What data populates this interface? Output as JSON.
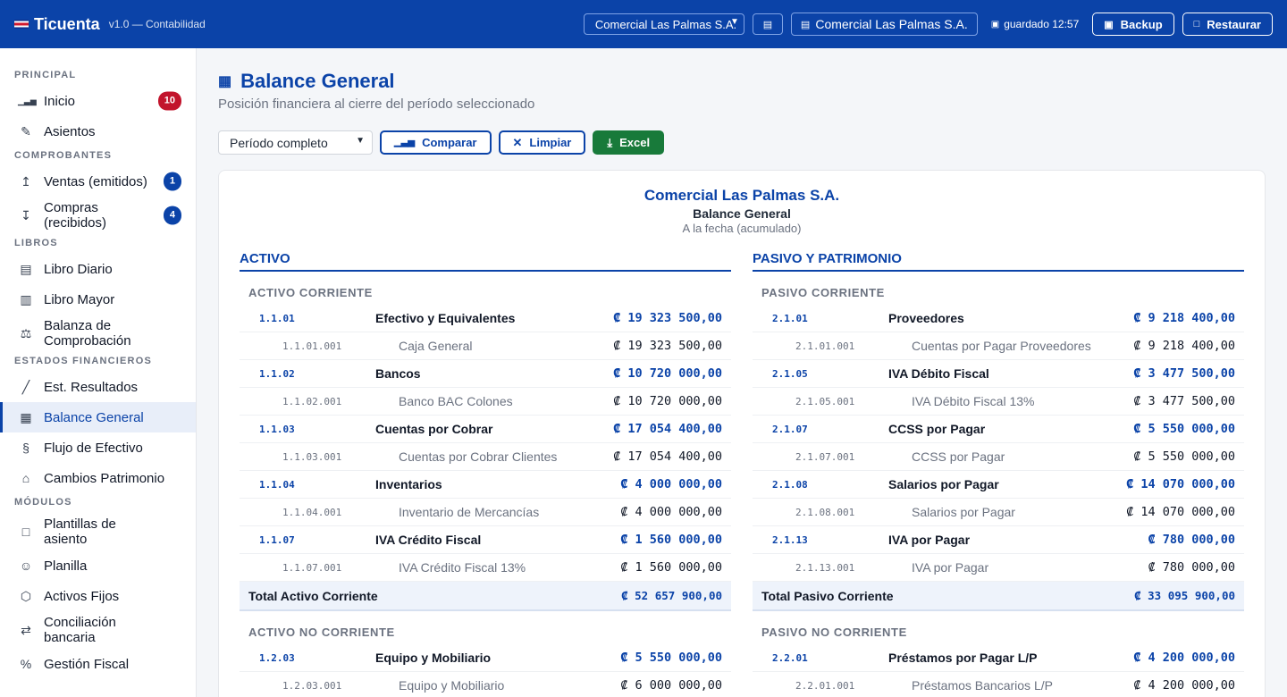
{
  "header": {
    "brand": "Ticuenta",
    "version": "v1.0 — Contabilidad",
    "company_select": "Comercial Las Palmas S.A.",
    "company_chip": "Comercial Las Palmas S.A.",
    "saved": "guardado 12:57",
    "backup_label": "Backup",
    "restore_label": "Restaurar"
  },
  "sidebar": {
    "sections": [
      {
        "title": "PRINCIPAL",
        "items": [
          {
            "label": "Inicio",
            "icon": "chart-icon",
            "badge": "10",
            "badge_color": "#c2142c"
          },
          {
            "label": "Asientos",
            "icon": "pencil-icon"
          }
        ]
      },
      {
        "title": "COMPROBANTES",
        "items": [
          {
            "label": "Ventas (emitidos)",
            "icon": "upload-icon",
            "badge": "1",
            "badge_color": "#0b43a8"
          },
          {
            "label": "Compras (recibidos)",
            "icon": "download-icon",
            "badge": "4",
            "badge_color": "#0b43a8"
          }
        ]
      },
      {
        "title": "LIBROS",
        "items": [
          {
            "label": "Libro Diario",
            "icon": "book-icon"
          },
          {
            "label": "Libro Mayor",
            "icon": "open-book-icon"
          },
          {
            "label": "Balanza de Comprobación",
            "icon": "scale-icon"
          }
        ]
      },
      {
        "title": "ESTADOS FINANCIEROS",
        "items": [
          {
            "label": "Est. Resultados",
            "icon": "line-chart-icon"
          },
          {
            "label": "Balance General",
            "icon": "table-icon",
            "active": true
          },
          {
            "label": "Flujo de Efectivo",
            "icon": "currency-icon"
          },
          {
            "label": "Cambios Patrimonio",
            "icon": "bank-icon"
          }
        ]
      },
      {
        "title": "MÓDULOS",
        "items": [
          {
            "label": "Plantillas de asiento",
            "icon": "template-icon"
          },
          {
            "label": "Planilla",
            "icon": "user-icon"
          },
          {
            "label": "Activos Fijos",
            "icon": "cube-icon"
          },
          {
            "label": "Conciliación bancaria",
            "icon": "swap-icon"
          },
          {
            "label": "Gestión Fiscal",
            "icon": "percent-icon"
          }
        ]
      }
    ]
  },
  "page": {
    "title": "Balance General",
    "subtitle": "Posición financiera al cierre del período seleccionado",
    "period": "Período completo",
    "compare_label": "Comparar",
    "clear_label": "Limpiar",
    "excel_label": "Excel"
  },
  "report": {
    "company": "Comercial Las Palmas S.A.",
    "title": "Balance General",
    "date": "A la fecha (acumulado)",
    "columns": [
      {
        "heading": "ACTIVO",
        "groups": [
          {
            "title": "ACTIVO CORRIENTE",
            "rows": [
              {
                "type": "parent",
                "code": "1.1.01",
                "name": "Efectivo y Equivalentes",
                "amount": "₡ 19 323 500,00"
              },
              {
                "type": "child",
                "code": "1.1.01.001",
                "name": "Caja General",
                "amount": "₡ 19 323 500,00"
              },
              {
                "type": "parent",
                "code": "1.1.02",
                "name": "Bancos",
                "amount": "₡ 10 720 000,00"
              },
              {
                "type": "child",
                "code": "1.1.02.001",
                "name": "Banco BAC Colones",
                "amount": "₡ 10 720 000,00"
              },
              {
                "type": "parent",
                "code": "1.1.03",
                "name": "Cuentas por Cobrar",
                "amount": "₡ 17 054 400,00"
              },
              {
                "type": "child",
                "code": "1.1.03.001",
                "name": "Cuentas por Cobrar Clientes",
                "amount": "₡ 17 054 400,00"
              },
              {
                "type": "parent",
                "code": "1.1.04",
                "name": "Inventarios",
                "amount": "₡ 4 000 000,00"
              },
              {
                "type": "child",
                "code": "1.1.04.001",
                "name": "Inventario de Mercancías",
                "amount": "₡ 4 000 000,00"
              },
              {
                "type": "parent",
                "code": "1.1.07",
                "name": "IVA Crédito Fiscal",
                "amount": "₡ 1 560 000,00"
              },
              {
                "type": "child",
                "code": "1.1.07.001",
                "name": "IVA Crédito Fiscal 13%",
                "amount": "₡ 1 560 000,00"
              },
              {
                "type": "total",
                "name": "Total Activo Corriente",
                "amount": "₡ 52 657 900,00"
              }
            ]
          },
          {
            "title": "ACTIVO NO CORRIENTE",
            "rows": [
              {
                "type": "parent",
                "code": "1.2.03",
                "name": "Equipo y Mobiliario",
                "amount": "₡ 5 550 000,00"
              },
              {
                "type": "child",
                "code": "1.2.03.001",
                "name": "Equipo y Mobiliario",
                "amount": "₡ 6 000 000,00"
              }
            ]
          }
        ]
      },
      {
        "heading": "PASIVO Y PATRIMONIO",
        "groups": [
          {
            "title": "PASIVO CORRIENTE",
            "rows": [
              {
                "type": "parent",
                "code": "2.1.01",
                "name": "Proveedores",
                "amount": "₡ 9 218 400,00"
              },
              {
                "type": "child",
                "code": "2.1.01.001",
                "name": "Cuentas por Pagar Proveedores",
                "amount": "₡ 9 218 400,00"
              },
              {
                "type": "parent",
                "code": "2.1.05",
                "name": "IVA Débito Fiscal",
                "amount": "₡ 3 477 500,00"
              },
              {
                "type": "child",
                "code": "2.1.05.001",
                "name": "IVA Débito Fiscal 13%",
                "amount": "₡ 3 477 500,00"
              },
              {
                "type": "parent",
                "code": "2.1.07",
                "name": "CCSS por Pagar",
                "amount": "₡ 5 550 000,00"
              },
              {
                "type": "child",
                "code": "2.1.07.001",
                "name": "CCSS por Pagar",
                "amount": "₡ 5 550 000,00"
              },
              {
                "type": "parent",
                "code": "2.1.08",
                "name": "Salarios por Pagar",
                "amount": "₡ 14 070 000,00"
              },
              {
                "type": "child",
                "code": "2.1.08.001",
                "name": "Salarios por Pagar",
                "amount": "₡ 14 070 000,00"
              },
              {
                "type": "parent",
                "code": "2.1.13",
                "name": "IVA por Pagar",
                "amount": "₡ 780 000,00"
              },
              {
                "type": "child",
                "code": "2.1.13.001",
                "name": "IVA por Pagar",
                "amount": "₡ 780 000,00"
              },
              {
                "type": "total",
                "name": "Total Pasivo Corriente",
                "amount": "₡ 33 095 900,00"
              }
            ]
          },
          {
            "title": "PASIVO NO CORRIENTE",
            "rows": [
              {
                "type": "parent",
                "code": "2.2.01",
                "name": "Préstamos por Pagar L/P",
                "amount": "₡ 4 200 000,00"
              },
              {
                "type": "child",
                "code": "2.2.01.001",
                "name": "Préstamos Bancarios L/P",
                "amount": "₡ 4 200 000,00"
              }
            ]
          }
        ]
      }
    ]
  }
}
